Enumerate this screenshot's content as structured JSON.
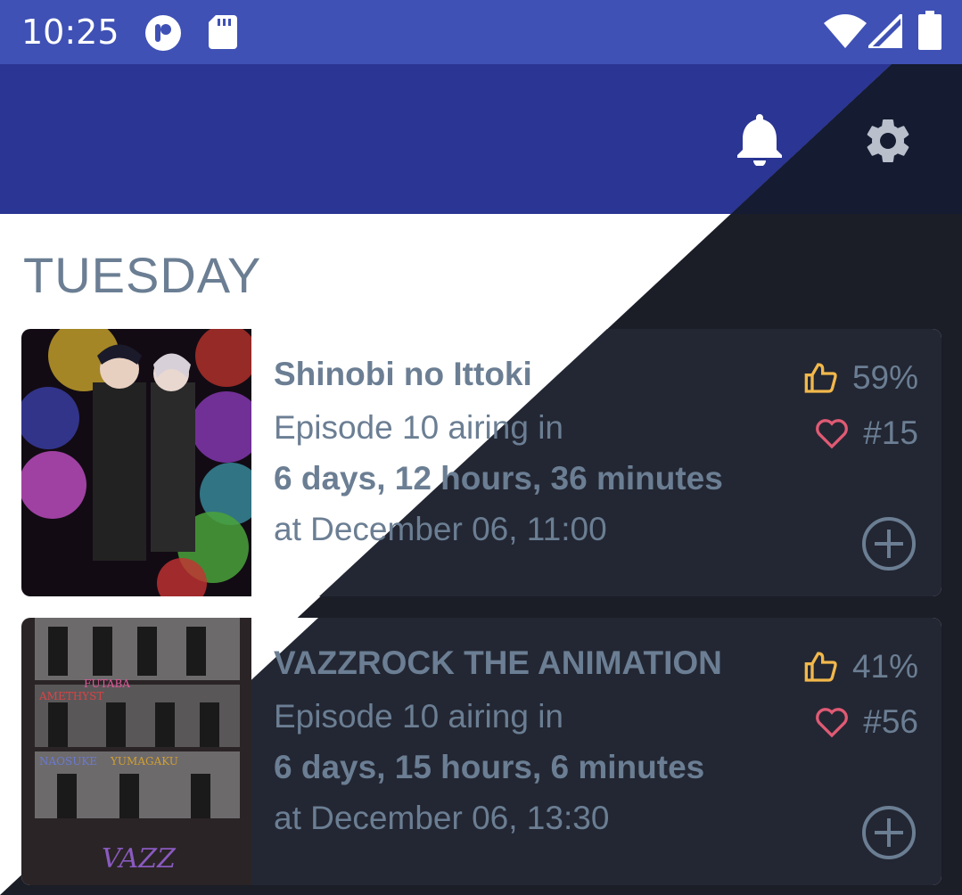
{
  "status_bar": {
    "time": "10:25",
    "icons": [
      "app-notification-icon",
      "sd-card-icon",
      "wifi-icon",
      "cell-signal-icon",
      "battery-icon"
    ]
  },
  "app_bar": {
    "actions": [
      "bell-icon",
      "gear-icon"
    ]
  },
  "section": {
    "title": "TUESDAY"
  },
  "colors": {
    "status_bar": "#3f51b5",
    "app_bar": "#2b3593",
    "dark_bg": "#1b1e27",
    "card_dark": "#232733",
    "text": "#6b7e93",
    "thumb_icon": "#f2b84b",
    "heart_icon": "#e05a74"
  },
  "cards": [
    {
      "title": "Shinobi no Ittoki",
      "episode_line": "Episode 10 airing in",
      "countdown": "6 days, 12 hours, 36 minutes",
      "airtime": "at December 06, 11:00",
      "score": "59%",
      "rank": "#15"
    },
    {
      "title": "VAZZROCK THE ANIMATION",
      "episode_line": "Episode 10 airing in",
      "countdown": "6 days, 15 hours, 6 minutes",
      "airtime": "at December 06, 13:30",
      "score": "41%",
      "rank": "#56"
    }
  ]
}
